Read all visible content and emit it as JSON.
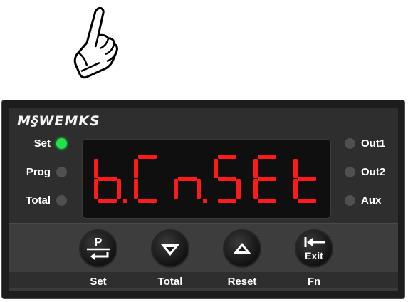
{
  "brand": {
    "logo": "M§WEMKS"
  },
  "indicators_left": [
    {
      "label": "Set",
      "on": true
    },
    {
      "label": "Prog",
      "on": false
    },
    {
      "label": "Total",
      "on": false
    }
  ],
  "indicators_right": [
    {
      "label": "Out1",
      "on": false
    },
    {
      "label": "Out2",
      "on": false
    },
    {
      "label": "Aux",
      "on": false
    }
  ],
  "display": {
    "text": "b.Cn.SEt",
    "color": "#ff1a1a"
  },
  "keys": [
    {
      "label": "Set",
      "glyph": "P",
      "icon": "enter-icon"
    },
    {
      "label": "Total",
      "glyph": "",
      "icon": "down-arrow-icon"
    },
    {
      "label": "Reset",
      "glyph": "",
      "icon": "up-arrow-icon"
    },
    {
      "label": "Fn",
      "glyph": "Exit",
      "icon": "back-arrow-icon"
    }
  ],
  "colors": {
    "led_on": "#1fe34a",
    "led_off": "#505050",
    "segment": "#ff1a1a",
    "panel": "#2e2e2e"
  }
}
